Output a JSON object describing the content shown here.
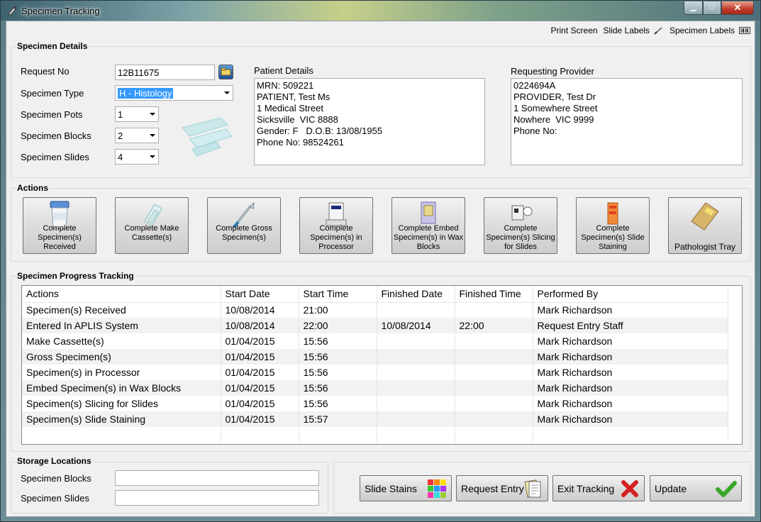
{
  "window": {
    "title": "Specimen Tracking"
  },
  "toolbar": {
    "print_screen": "Print Screen",
    "slide_labels": "Slide Labels",
    "specimen_labels": "Specimen Labels"
  },
  "specimen_details": {
    "group_label": "Specimen Details",
    "request_no_label": "Request No",
    "request_no": "12B11675",
    "type_label": "Specimen Type",
    "type_value": "H - Histology",
    "pots_label": "Specimen Pots",
    "pots_value": "1",
    "blocks_label": "Specimen Blocks",
    "blocks_value": "2",
    "slides_label": "Specimen Slides",
    "slides_value": "4"
  },
  "patient": {
    "label": "Patient Details",
    "text": "MRN: 509221\nPATIENT, Test Ms\n1 Medical Street\nSicksville  VIC 8888\nGender: F   D.O.B: 13/08/1955\nPhone No: 98524261"
  },
  "provider": {
    "label": "Requesting Provider",
    "text": "0224694A\nPROVIDER, Test Dr\n1 Somewhere Street\nNowhere  VIC 9999\nPhone No:"
  },
  "actions": {
    "group_label": "Actions",
    "buttons": [
      {
        "label": "Complete Specimen(s) Received",
        "icon": "specimen-cup-icon"
      },
      {
        "label": "Complete Make Cassette(s)",
        "icon": "cassette-icon"
      },
      {
        "label": "Complete Gross Specimen(s)",
        "icon": "scalpel-icon"
      },
      {
        "label": "Complete Specimen(s) in Processor",
        "icon": "processor-icon"
      },
      {
        "label": "Complete Embed Specimen(s) in Wax Blocks",
        "icon": "wax-block-icon"
      },
      {
        "label": "Complete Specimen(s) Slicing for Slides",
        "icon": "microtome-icon"
      },
      {
        "label": "Complete Specimen(s) Slide Staining",
        "icon": "staining-icon"
      },
      {
        "label": "Pathologist Tray",
        "icon": "folder-tray-icon"
      }
    ]
  },
  "progress": {
    "group_label": "Specimen Progress Tracking",
    "columns": [
      "Actions",
      "Start Date",
      "Start Time",
      "Finished Date",
      "Finished Time",
      "Performed By"
    ],
    "rows": [
      [
        "Specimen(s) Received",
        "10/08/2014",
        "21:00",
        "",
        "",
        "Mark Richardson"
      ],
      [
        "Entered In APLIS System",
        "10/08/2014",
        "22:00",
        "10/08/2014",
        "22:00",
        "Request Entry Staff"
      ],
      [
        "Make Cassette(s)",
        "01/04/2015",
        "15:56",
        "",
        "",
        "Mark Richardson"
      ],
      [
        "Gross Specimen(s)",
        "01/04/2015",
        "15:56",
        "",
        "",
        "Mark Richardson"
      ],
      [
        "Specimen(s) in Processor",
        "01/04/2015",
        "15:56",
        "",
        "",
        "Mark Richardson"
      ],
      [
        "Embed Specimen(s) in Wax Blocks",
        "01/04/2015",
        "15:56",
        "",
        "",
        "Mark Richardson"
      ],
      [
        "Specimen(s) Slicing for Slides",
        "01/04/2015",
        "15:56",
        "",
        "",
        "Mark Richardson"
      ],
      [
        "Specimen(s) Slide Staining",
        "01/04/2015",
        "15:57",
        "",
        "",
        "Mark Richardson"
      ]
    ]
  },
  "storage": {
    "group_label": "Storage Locations",
    "blocks_label": "Specimen Blocks",
    "blocks_value": "",
    "slides_label": "Specimen Slides",
    "slides_value": ""
  },
  "footer": {
    "slide_stains": "Slide Stains",
    "request_entry": "Request Entry",
    "exit_tracking": "Exit Tracking",
    "update": "Update"
  }
}
